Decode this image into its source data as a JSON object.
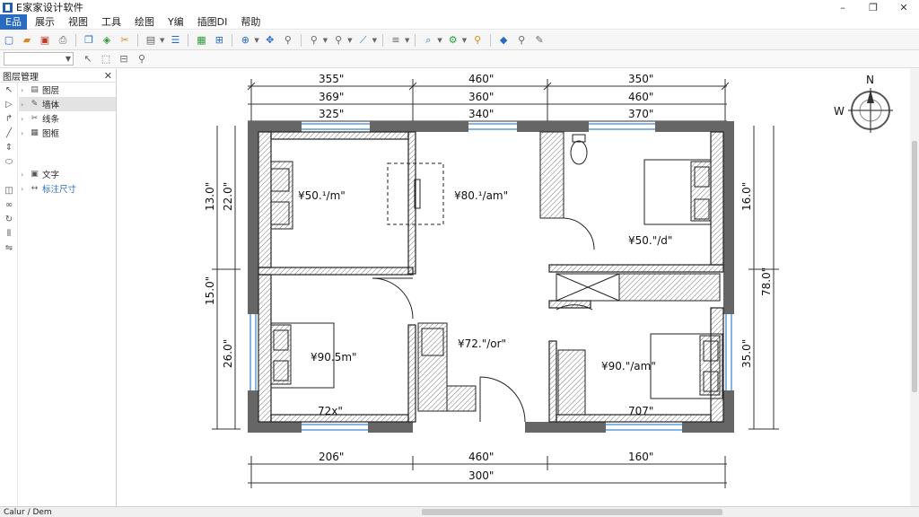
{
  "window": {
    "title": "E家家设计软件",
    "minimize_glyph": "–",
    "restore_glyph": "❐",
    "close_glyph": "✕"
  },
  "menu": {
    "items": [
      "E品",
      "展示",
      "视图",
      "工具",
      "绘图",
      "Y编",
      "插图DI",
      "帮助"
    ]
  },
  "panel": {
    "title": "图层管理",
    "close_glyph": "✕",
    "tree_items": [
      {
        "label": "图层",
        "icon": "layer-icon",
        "selected": false,
        "highlight": false
      },
      {
        "label": "墙体",
        "icon": "wall-icon",
        "selected": true,
        "highlight": false
      },
      {
        "label": "线条",
        "icon": "line-icon",
        "selected": false,
        "highlight": false
      },
      {
        "label": "图框",
        "icon": "frame-icon",
        "selected": false,
        "highlight": false
      },
      {
        "label": "文字",
        "icon": "text-icon",
        "selected": false,
        "highlight": false
      },
      {
        "label": "标注尺寸",
        "icon": "dimension-icon",
        "selected": false,
        "highlight": true
      }
    ]
  },
  "compass": {
    "north": "N",
    "west": "W"
  },
  "plan": {
    "dims_top": [
      "355\"",
      "460\"",
      "350\"",
      "369\"",
      "360\"",
      "460\"",
      "325\"",
      "340\"",
      "370\""
    ],
    "dims_bottom": [
      "206\"",
      "460\"",
      "160\"",
      "300\""
    ],
    "dims_left": [
      "13.0\"",
      "22.0\"",
      "15.0\"",
      "26.0\""
    ],
    "dims_right": [
      "16.0\"",
      "78.0\"",
      "35.0\""
    ],
    "rooms": [
      {
        "name": "bedroom-top-left",
        "label": "¥50.¹/m\""
      },
      {
        "name": "study-top-middle",
        "label": "¥80.¹/am\""
      },
      {
        "name": "bedroom-top-right",
        "label": "¥50.\"/d\""
      },
      {
        "name": "bedroom-bottom-left",
        "label": "¥90.5m\""
      },
      {
        "name": "living-center",
        "label": "¥72.\"/or\""
      },
      {
        "name": "bedroom-bottom-right",
        "label": "¥90.\"/am\""
      },
      {
        "name": "bottom-left-width",
        "label": "72x\""
      },
      {
        "name": "bottom-right-width",
        "label": "707\""
      }
    ]
  },
  "status": {
    "text": "Calur / Dem"
  }
}
